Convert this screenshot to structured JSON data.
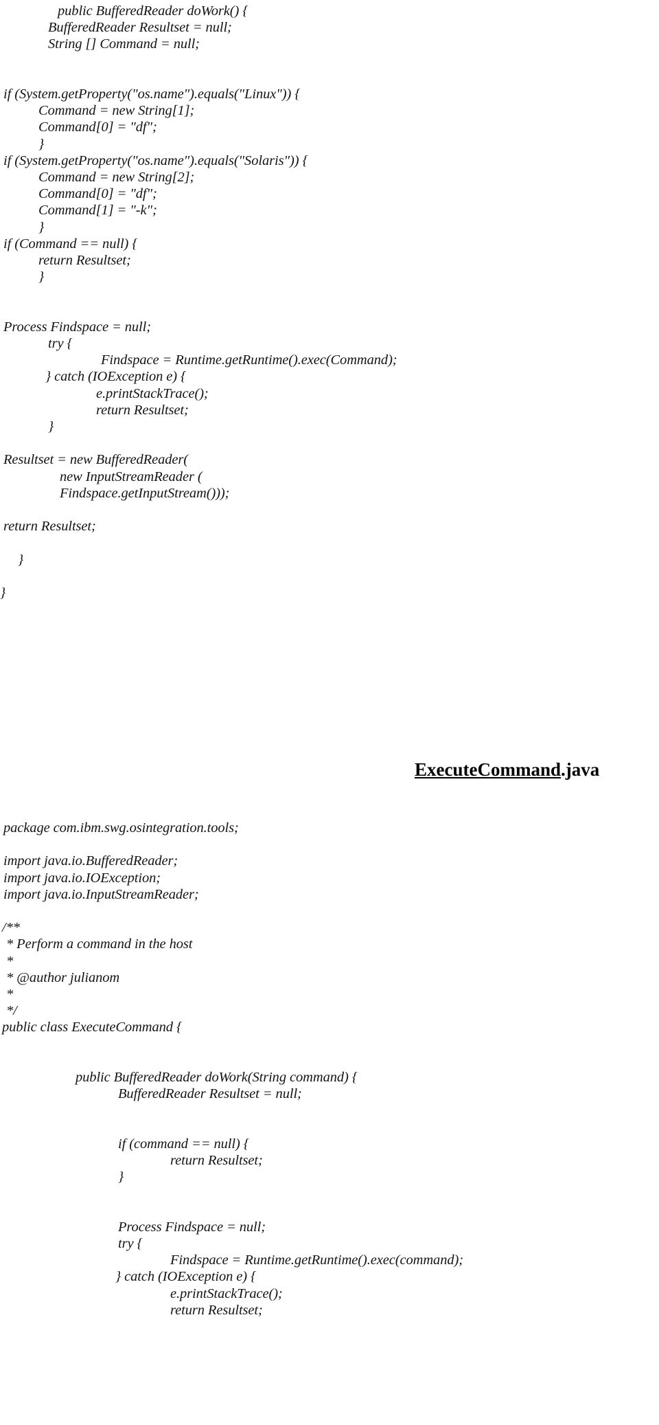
{
  "document": {
    "kind": "scanned-source-code-listing",
    "background_color": "#ffffff",
    "text_color": "#141414",
    "heading_color": "#000000"
  },
  "heading": {
    "underlined_part": "ExecuteCommand",
    "plain_part": ".java",
    "full_text": "ExecuteCommand.java"
  },
  "listing_top": {
    "lines": [
      {
        "indent": 84,
        "text": "public BufferedReader doWork() {"
      },
      {
        "indent": 70,
        "text": "BufferedReader Resultset = null;"
      },
      {
        "indent": 70,
        "text": "String [] Command = null;"
      },
      {
        "indent": 0,
        "text": ""
      },
      {
        "indent": 0,
        "text": ""
      },
      {
        "indent": 5,
        "text": "if (System.getProperty(\"os.name\").equals(\"Linux\")) {"
      },
      {
        "indent": 56,
        "text": "Command = new String[1];"
      },
      {
        "indent": 56,
        "text": "Command[0] = \"df\";"
      },
      {
        "indent": 56,
        "text": "}"
      },
      {
        "indent": 5,
        "text": "if (System.getProperty(\"os.name\").equals(\"Solaris\")) {"
      },
      {
        "indent": 56,
        "text": "Command = new String[2];"
      },
      {
        "indent": 56,
        "text": "Command[0] = \"df\";"
      },
      {
        "indent": 56,
        "text": "Command[1] = \"-k\";"
      },
      {
        "indent": 56,
        "text": "}"
      },
      {
        "indent": 5,
        "text": "if (Command == null) {"
      },
      {
        "indent": 56,
        "text": "return Resultset;"
      },
      {
        "indent": 56,
        "text": "}"
      },
      {
        "indent": 0,
        "text": ""
      },
      {
        "indent": 0,
        "text": ""
      },
      {
        "indent": 5,
        "text": "Process Findspace = null;"
      },
      {
        "indent": 70,
        "text": "try {"
      },
      {
        "indent": 147,
        "text": "Findspace = Runtime.getRuntime().exec(Command);"
      },
      {
        "indent": 66,
        "text": "} catch (IOException e) {"
      },
      {
        "indent": 140,
        "text": "e.printStackTrace();"
      },
      {
        "indent": 140,
        "text": "return Resultset;"
      },
      {
        "indent": 70,
        "text": "}"
      },
      {
        "indent": 0,
        "text": ""
      },
      {
        "indent": 5,
        "text": "Resultset = new BufferedReader("
      },
      {
        "indent": 87,
        "text": "new InputStreamReader ("
      },
      {
        "indent": 87,
        "text": "Findspace.getInputStream()));"
      },
      {
        "indent": 0,
        "text": ""
      },
      {
        "indent": 5,
        "text": "return Resultset;"
      },
      {
        "indent": 0,
        "text": ""
      },
      {
        "indent": 26,
        "text": "}"
      },
      {
        "indent": 0,
        "text": ""
      },
      {
        "indent": 0,
        "text": "}"
      }
    ]
  },
  "listing_bottom": {
    "lines": [
      {
        "indent": 5,
        "text": "package com.ibm.swg.osintegration.tools;"
      },
      {
        "indent": 0,
        "text": ""
      },
      {
        "indent": 5,
        "text": "import java.io.BufferedReader;"
      },
      {
        "indent": 5,
        "text": "import java.io.IOException;"
      },
      {
        "indent": 5,
        "text": "import java.io.InputStreamReader;"
      },
      {
        "indent": 0,
        "text": ""
      },
      {
        "indent": 3,
        "text": "/**"
      },
      {
        "indent": 9,
        "text": "* Perform a command in the host"
      },
      {
        "indent": 9,
        "text": "*"
      },
      {
        "indent": 9,
        "text": "* @author julianom"
      },
      {
        "indent": 9,
        "text": "*"
      },
      {
        "indent": 9,
        "text": "*/"
      },
      {
        "indent": 3,
        "text": "public class ExecuteCommand {"
      },
      {
        "indent": 0,
        "text": ""
      },
      {
        "indent": 0,
        "text": ""
      },
      {
        "indent": 110,
        "text": "public BufferedReader doWork(String command) {"
      },
      {
        "indent": 172,
        "text": "BufferedReader Resultset = null;"
      },
      {
        "indent": 0,
        "text": ""
      },
      {
        "indent": 0,
        "text": ""
      },
      {
        "indent": 172,
        "text": "if (command == null) {"
      },
      {
        "indent": 248,
        "text": "return Resultset;"
      },
      {
        "indent": 172,
        "text": "}"
      },
      {
        "indent": 0,
        "text": ""
      },
      {
        "indent": 0,
        "text": ""
      },
      {
        "indent": 172,
        "text": "Process Findspace = null;"
      },
      {
        "indent": 172,
        "text": "try {"
      },
      {
        "indent": 248,
        "text": "Findspace = Runtime.getRuntime().exec(command);"
      },
      {
        "indent": 168,
        "text": "} catch (IOException e) {"
      },
      {
        "indent": 248,
        "text": "e.printStackTrace();"
      },
      {
        "indent": 248,
        "text": "return Resultset;"
      }
    ]
  }
}
